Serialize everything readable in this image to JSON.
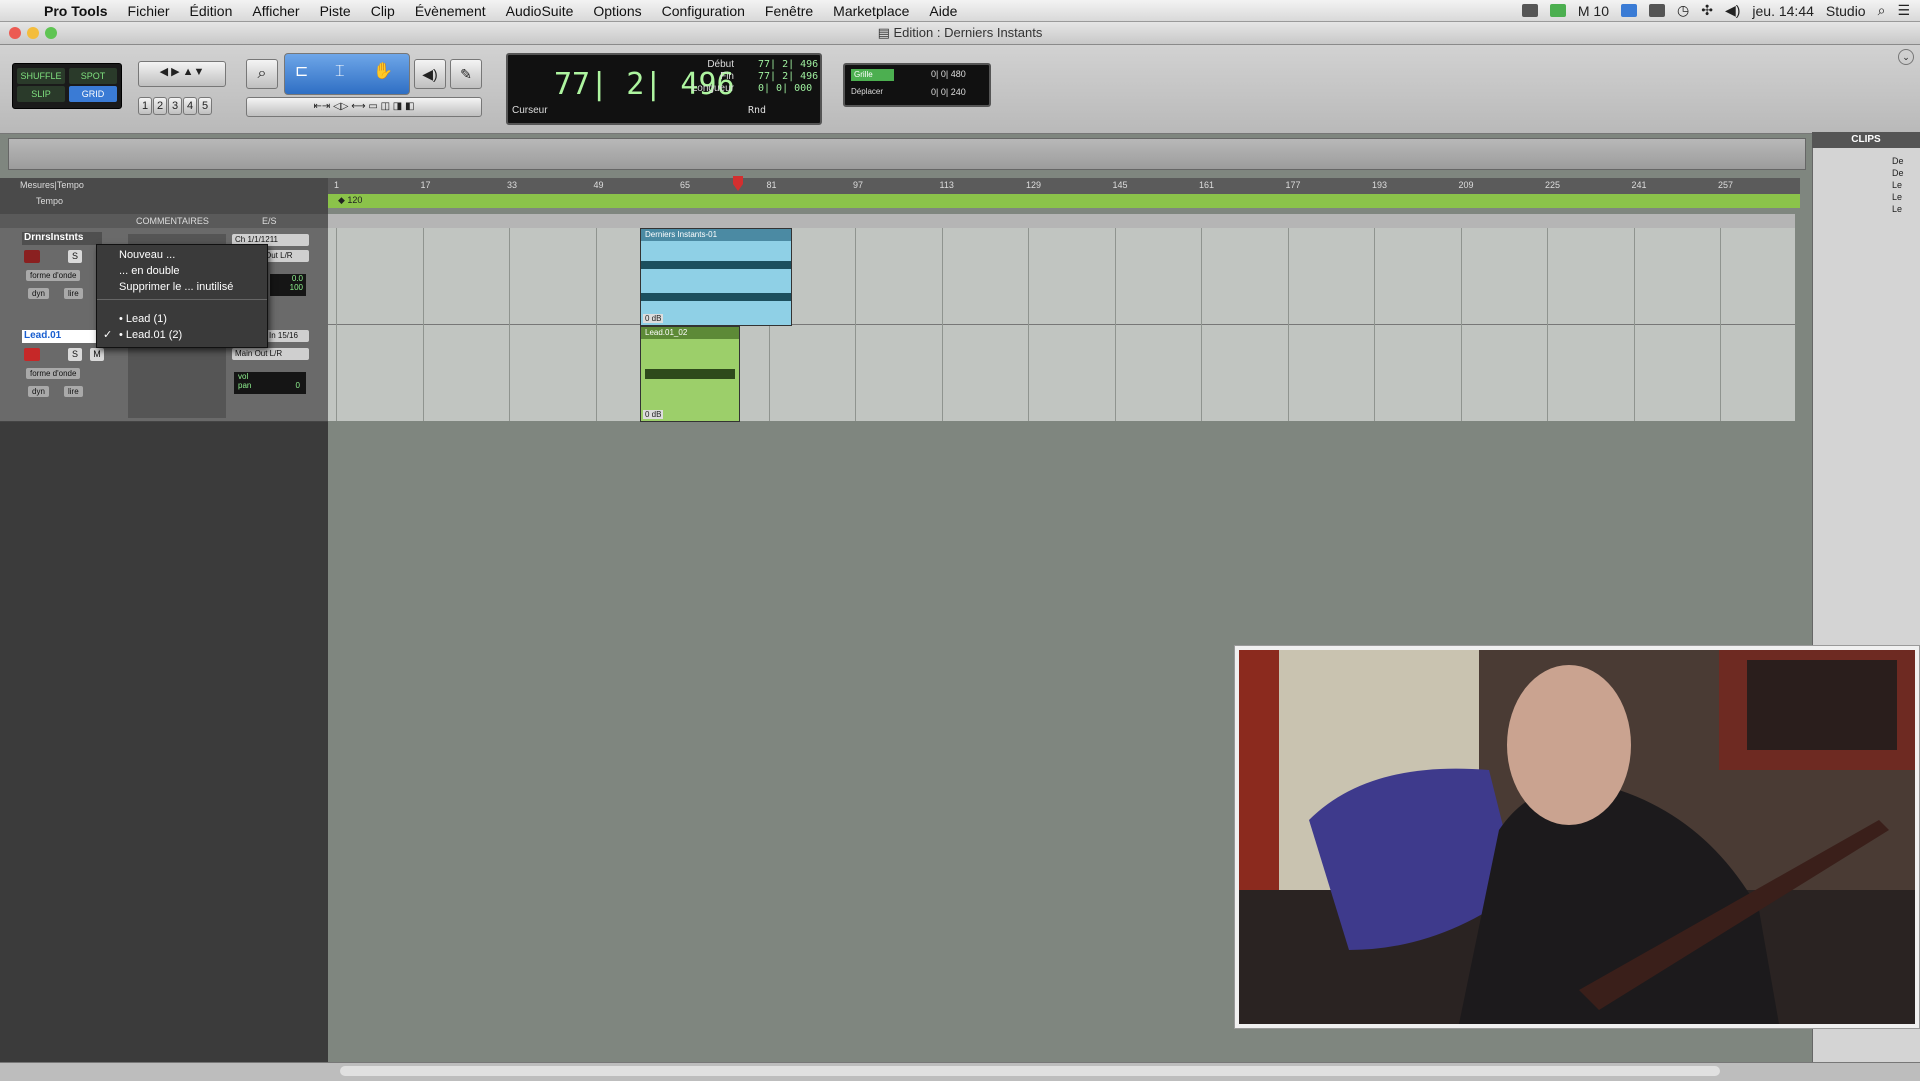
{
  "menubar": {
    "app": "Pro Tools",
    "items": [
      "Fichier",
      "Édition",
      "Afficher",
      "Piste",
      "Clip",
      "Évènement",
      "AudioSuite",
      "Options",
      "Configuration",
      "Fenêtre",
      "Marketplace",
      "Aide"
    ],
    "right": {
      "counter": "10",
      "clock": "jeu. 14:44",
      "user": "Studio"
    }
  },
  "window": {
    "title": "Edition : Derniers Instants"
  },
  "toolbar": {
    "modes": [
      "SHUFFLE",
      "SPOT",
      "SLIP",
      "GRID"
    ],
    "zoom_presets": [
      "1",
      "2",
      "3",
      "4",
      "5"
    ],
    "counter": {
      "main": "77| 2| 496",
      "start_label": "Début",
      "end_label": "Fin",
      "length_label": "Longueur",
      "start": "77| 2| 496",
      "end": "77| 2| 496",
      "length": "0| 0| 000",
      "cursor_label": "Curseur",
      "rnd": "Rnd"
    },
    "grid": {
      "grid_label": "Grille",
      "grid_value": "0| 0| 480",
      "nudge_label": "Déplacer",
      "nudge_value": "0| 0| 240"
    }
  },
  "ruler": {
    "label_main": "Mesures|Tempo",
    "label_tempo": "Tempo",
    "tempo_value": "120",
    "ticks": [
      "1",
      "17",
      "33",
      "49",
      "65",
      "81",
      "97",
      "113",
      "129",
      "145",
      "161",
      "177",
      "193",
      "209",
      "225",
      "241",
      "257"
    ]
  },
  "columns": {
    "comments": "COMMENTAIRES",
    "io": "E/S"
  },
  "tracks": [
    {
      "name": "DrnrsInstnts",
      "io_in": "Ch 1/1/1211",
      "io_out": "Out L/R",
      "view": "forme d'onde",
      "dyn": "dyn",
      "lire": "lire",
      "vol": "0.0",
      "pan": "100"
    },
    {
      "name": "Lead.01",
      "io_in": "In 15/16",
      "io_out": "Main Out L/R",
      "view": "forme d'onde",
      "dyn": "dyn",
      "lire": "lire",
      "vol": "vol",
      "pan": "pan",
      "pan_val": "0"
    }
  ],
  "popup": {
    "items": [
      "Nouveau ...",
      "... en double",
      "Supprimer le ... inutilisé",
      "Lead (1)",
      "Lead.01 (2)"
    ],
    "checked": "Lead.01 (2)"
  },
  "clips": [
    {
      "name": "Derniers Instants-01",
      "color": "#8fd0e6",
      "gain": "0 dB"
    },
    {
      "name": "Lead.01_02",
      "color": "#9ccf6a",
      "gain": "0 dB"
    }
  ],
  "clips_panel": {
    "title": "CLIPS",
    "items": [
      "De",
      "De",
      "Le",
      "Le",
      "Le"
    ]
  },
  "colors": {
    "accent": "#3a7bd5",
    "record": "#c62828",
    "tempo": "#8bc34a"
  }
}
